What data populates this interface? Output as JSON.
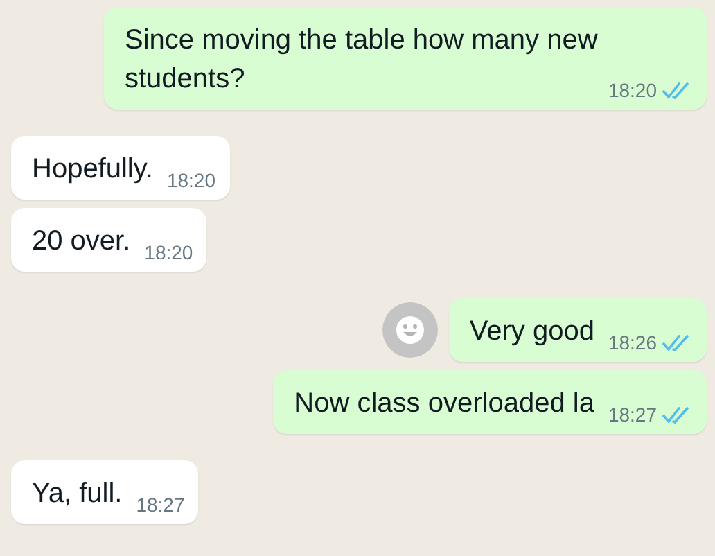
{
  "messages": [
    {
      "kind": "outgoing",
      "text": "Since moving the table how many new students?",
      "time": "18:20",
      "read": true,
      "react_button": false
    },
    {
      "kind": "incoming",
      "text": "Hopefully.",
      "time": "18:20"
    },
    {
      "kind": "incoming",
      "text": "20 over.",
      "time": "18:20"
    },
    {
      "kind": "outgoing",
      "text": "Very good",
      "time": "18:26",
      "read": true,
      "react_button": true
    },
    {
      "kind": "outgoing",
      "text": "Now class overloaded la",
      "time": "18:27",
      "read": true,
      "react_button": false
    },
    {
      "kind": "incoming",
      "text": "Ya, full.",
      "time": "18:27"
    }
  ]
}
